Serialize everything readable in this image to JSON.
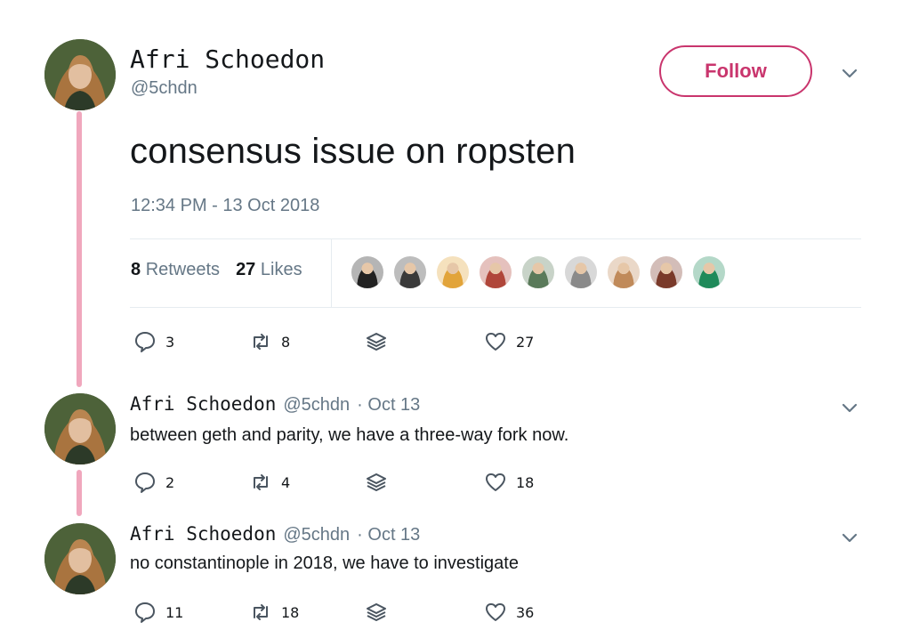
{
  "main_tweet": {
    "author_name": "Afri Schoedon",
    "author_handle": "@5chdn",
    "follow_label": "Follow",
    "text": "consensus issue on ropsten",
    "timestamp": "12:34 PM - 13 Oct 2018",
    "retweets_count": "8",
    "retweets_label": "Retweets",
    "likes_count": "27",
    "likes_label": "Likes",
    "likers": [
      {
        "color": "#222222"
      },
      {
        "color": "#3a3a3a"
      },
      {
        "color": "#e2a43a"
      },
      {
        "color": "#b0463a"
      },
      {
        "color": "#5a7a5a"
      },
      {
        "color": "#8a8a8a"
      },
      {
        "color": "#c08a5a"
      },
      {
        "color": "#7a3a2a"
      },
      {
        "color": "#1f8a5a"
      }
    ],
    "actions": {
      "replies": "3",
      "retweets": "8",
      "likes": "27"
    }
  },
  "replies": [
    {
      "author_name": "Afri Schoedon",
      "author_handle": "@5chdn",
      "date": "· Oct 13",
      "text": "between geth and parity, we have a three-way fork now.",
      "actions": {
        "replies": "2",
        "retweets": "4",
        "likes": "18"
      }
    },
    {
      "author_name": "Afri Schoedon",
      "author_handle": "@5chdn",
      "date": "· Oct 13",
      "text": "no constantinople in 2018, we have to investigate",
      "actions": {
        "replies": "11",
        "retweets": "18",
        "likes": "36"
      }
    }
  ],
  "colors": {
    "accent": "#c9356d",
    "thread_line": "#f0a7bd",
    "muted": "#657786"
  },
  "icons": {
    "reply": "reply-icon",
    "retweet": "retweet-icon",
    "direct_message": "direct-message-icon",
    "like": "like-icon",
    "more": "chevron-down-icon"
  }
}
